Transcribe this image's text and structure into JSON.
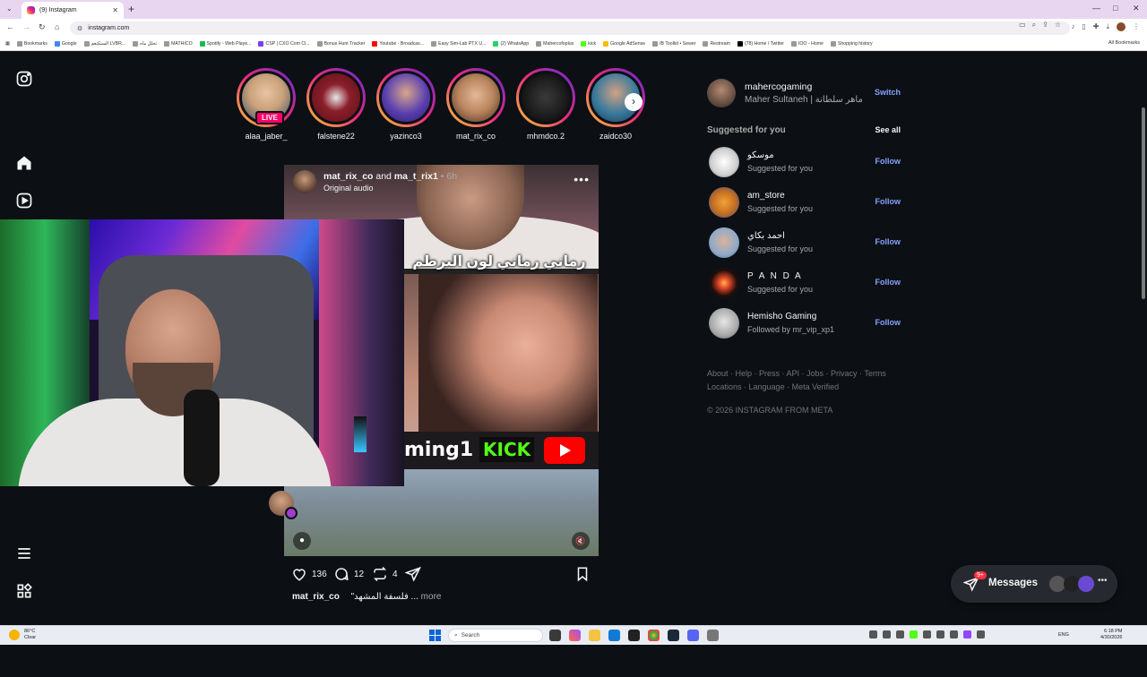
{
  "browser": {
    "tab_title": "(9) Instagram",
    "url": "instagram.com",
    "bookmarks": [
      "Bookmarks",
      "Google",
      "الستكتعم LVBR...",
      "تحلل ماه",
      "MATHICO",
      "Spotify - Web Playe...",
      "CSP | CXO Com Cl...",
      "Bonus Hunt Tracker",
      "Youtube - Broadcas...",
      "Easy Sim-Lab PTX U...",
      "(2) WhatsApp",
      "Mahercofoplus",
      "kick",
      "Google AdSense",
      "IB Toolkit • Sewer",
      "Restream",
      "(78) Home / Twitter",
      "IOO - Home",
      "Shopping history"
    ],
    "all_bookmarks": "All Bookmarks"
  },
  "stories": [
    {
      "name": "alaa_jaber_",
      "live": "LIVE",
      "color": "#c9a27a"
    },
    {
      "name": "falstene22",
      "color": "#8a1f2a"
    },
    {
      "name": "yazinco3",
      "color": "#5a3fb0"
    },
    {
      "name": "mat_rix_co",
      "color": "#b7835c"
    },
    {
      "name": "mhmdco.2",
      "color": "#1a1a1a"
    },
    {
      "name": "zaidco30",
      "color": "#3a7a9c"
    }
  ],
  "post": {
    "user1": "mat_rix_co",
    "and": "and",
    "user2": "ma_t_rix1",
    "time": "• 6h",
    "audio": "Original audio",
    "caption_overlay": "رماني رماني لون البرطم",
    "banner_text": "ming1",
    "banner_kick": "KICK",
    "likes": "136",
    "comments": "12",
    "reposts": "4",
    "caption_user": "mat_rix_co",
    "caption_text": "\"فلسفة المشهد ...",
    "caption_more": "more"
  },
  "me": {
    "username": "mahercogaming",
    "name": "Maher Sultaneh | ماهر سلطانة",
    "switch": "Switch"
  },
  "suggested": {
    "title": "Suggested for you",
    "see_all": "See all",
    "items": [
      {
        "user": "موسكو",
        "sub": "Suggested for you",
        "action": "Follow",
        "color": "#e7e7e7"
      },
      {
        "user": "am_store",
        "sub": "Suggested for you",
        "action": "Follow",
        "color": "#c8701f"
      },
      {
        "user": "احمد بكاي",
        "sub": "Suggested for you",
        "action": "Follow",
        "color": "#8fa9c9"
      },
      {
        "user": "P A N D A",
        "sub": "Suggested for you",
        "action": "Follow",
        "color": "#1d0e0a"
      },
      {
        "user": "Hemisho Gaming",
        "sub": "Followed by mr_vip_xp1",
        "action": "Follow",
        "color": "#c9c9c9"
      }
    ]
  },
  "footer": {
    "links_line1": "About · Help · Press · API · Jobs · Privacy · Terms",
    "links_line2": "Locations · Language · Meta Verified",
    "copyright": "© 2026 INSTAGRAM FROM META"
  },
  "messages": {
    "label": "Messages",
    "badge": "9+"
  },
  "taskbar": {
    "weather_temp": "86°C",
    "weather_desc": "Clear",
    "search_placeholder": "Search",
    "lang": "ENG",
    "time": "6:18 PM",
    "date": "4/30/2026"
  }
}
